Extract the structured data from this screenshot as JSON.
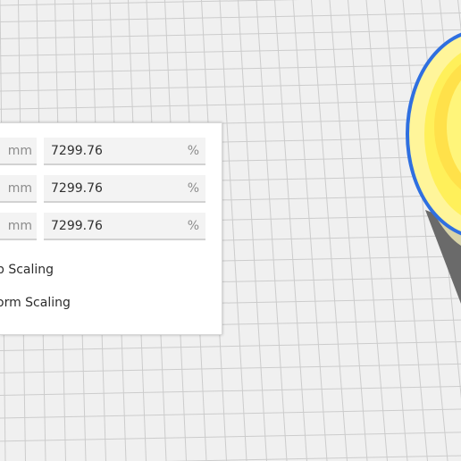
{
  "scale_panel": {
    "rows": [
      {
        "mm_unit": "mm",
        "percent_value": "7299.76",
        "percent_unit": "%"
      },
      {
        "mm_unit": "mm",
        "percent_value": "7299.76",
        "percent_unit": "%"
      },
      {
        "mm_unit": "mm",
        "percent_value": "7299.76",
        "percent_unit": "%"
      }
    ],
    "snap_scaling_label": "p Scaling",
    "uniform_scaling_label": "orm Scaling"
  },
  "colors": {
    "viewport_background": "#f0f0f0",
    "grid_line": "#cfcfcf",
    "model_yellow": "#ffef4a",
    "model_outline": "#2f6fe0",
    "model_shadow": "#555555"
  }
}
